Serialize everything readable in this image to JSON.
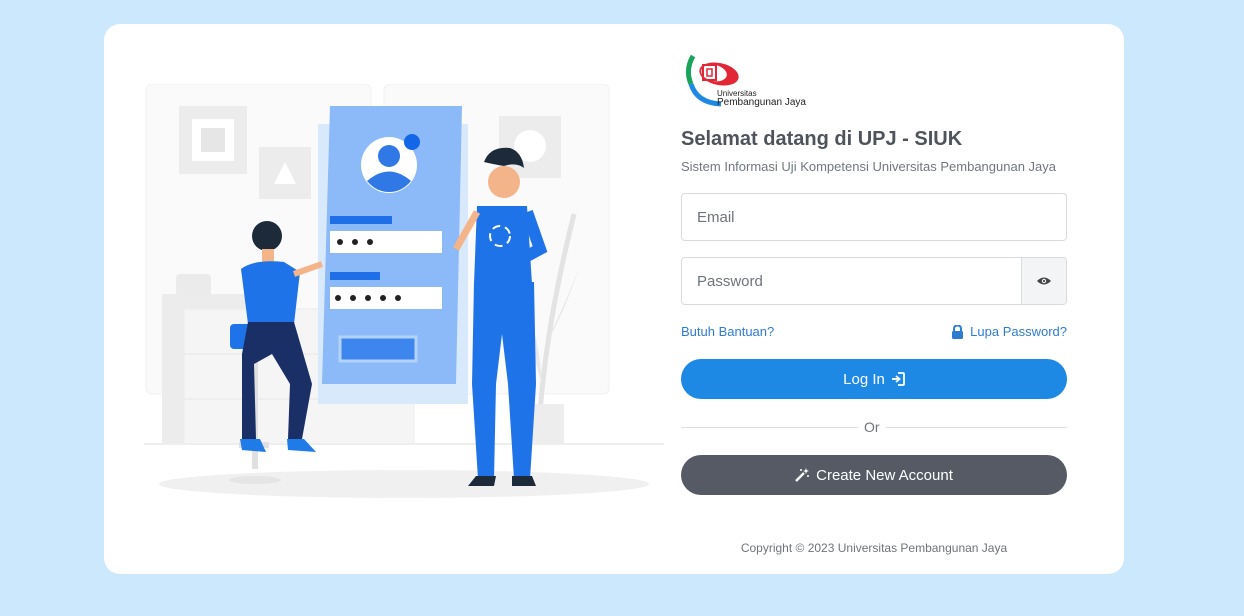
{
  "brand": {
    "logo_line1": "Universitas",
    "logo_line2": "Pembangunan Jaya"
  },
  "header": {
    "title": "Selamat datang di UPJ - SIUK",
    "subtitle": "Sistem Informasi Uji Kompetensi Universitas Pembangunan Jaya"
  },
  "form": {
    "email_placeholder": "Email",
    "email_value": "",
    "password_placeholder": "Password",
    "password_value": "",
    "help_link": "Butuh Bantuan?",
    "forgot_link": "Lupa Password?",
    "login_label": "Log In",
    "or_label": "Or",
    "create_label": "Create New Account"
  },
  "footer": {
    "copyright": "Copyright © 2023 Universitas Pembangunan Jaya"
  },
  "colors": {
    "page_bg": "#cce8fc",
    "primary": "#1e88e5",
    "secondary": "#555a65",
    "link": "#2e7dd1"
  },
  "icons": {
    "eye": "eye-icon",
    "lock": "lock-icon",
    "login": "sign-in-icon",
    "create": "magic-wand-icon"
  }
}
